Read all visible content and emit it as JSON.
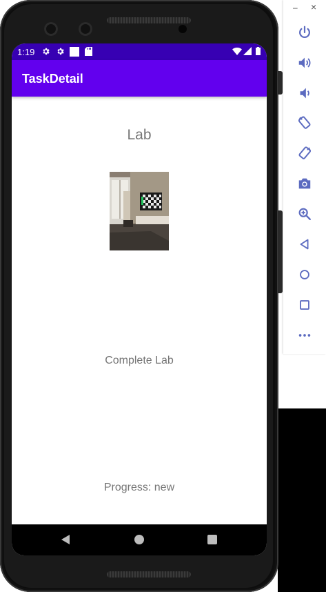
{
  "status_bar": {
    "time": "1:19",
    "left_icons": [
      "settings-icon",
      "settings-icon",
      "notification-square-icon",
      "sd-card-icon"
    ],
    "right_icons": [
      "wifi-icon",
      "signal-icon",
      "battery-icon"
    ]
  },
  "app_bar": {
    "title": "TaskDetail"
  },
  "task": {
    "title": "Lab",
    "image": "room-photo",
    "complete_button_label": "Complete Lab",
    "progress_text": "Progress: new"
  },
  "nav_bar": {
    "buttons": [
      "back-icon",
      "home-icon",
      "recents-icon"
    ]
  },
  "emulator_panel": {
    "window_controls": [
      "minimize-icon",
      "close-icon"
    ],
    "minimize_glyph": "–",
    "close_glyph": "×",
    "tools": [
      "power-icon",
      "volume-up-icon",
      "volume-down-icon",
      "rotate-left-icon",
      "rotate-right-icon",
      "camera-icon",
      "zoom-icon",
      "back-icon",
      "home-icon",
      "overview-icon",
      "more-icon"
    ]
  },
  "colors": {
    "primary": "#6200ee",
    "primary_dark": "#3700b3",
    "text_secondary": "#757575",
    "emulator_icon": "#5c6bc0"
  }
}
